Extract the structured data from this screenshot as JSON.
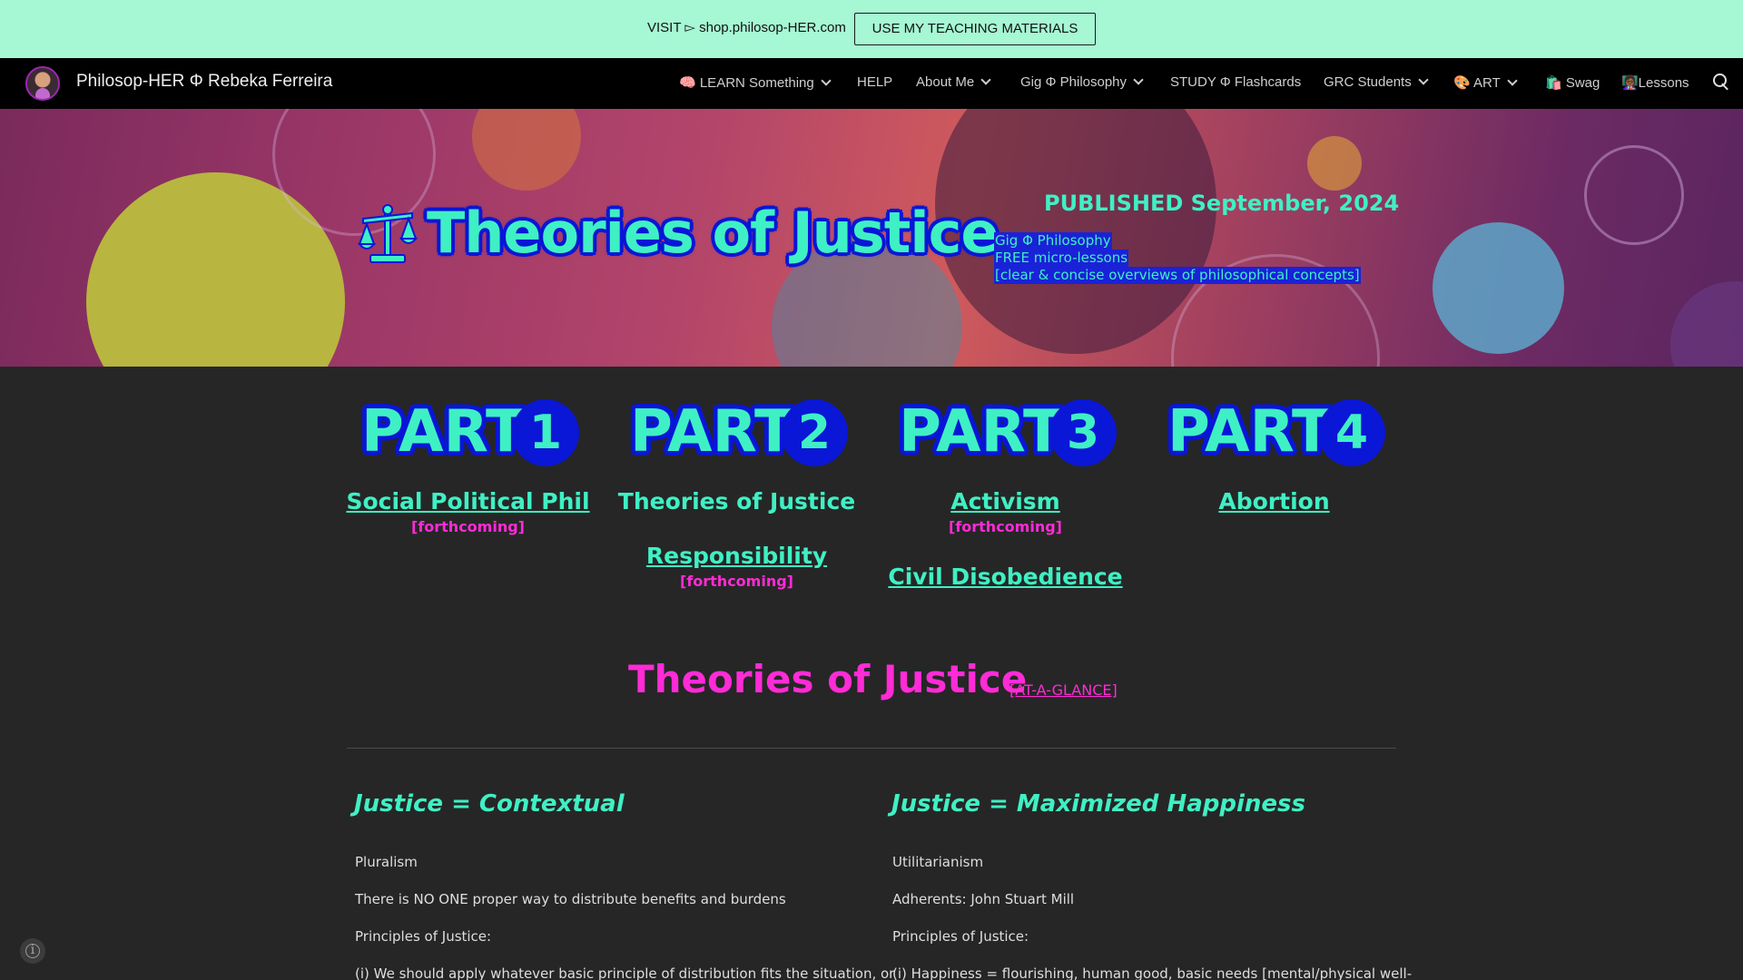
{
  "announcement": {
    "text": "VISIT ▻ shop.philosop-HER.com",
    "button_label": "USE MY TEACHING MATERIALS",
    "background": "#a6f7d3"
  },
  "nav": {
    "site_title": "Philosop-HER Φ Rebeka Ferreira",
    "items": [
      {
        "label": "🧠 LEARN Something",
        "dropdown": true
      },
      {
        "label": "HELP",
        "dropdown": false
      },
      {
        "label": "About Me",
        "dropdown": true
      },
      {
        "label": "Gig Φ Philosophy",
        "dropdown": true
      },
      {
        "label": "STUDY Φ Flashcards",
        "dropdown": false
      },
      {
        "label": "GRC Students",
        "dropdown": true
      },
      {
        "label": "🎨 ART",
        "dropdown": true
      },
      {
        "label": "🛍️ Swag",
        "dropdown": false
      },
      {
        "label": "👩🏾‍🏫Lessons",
        "dropdown": false
      }
    ],
    "search_icon": "search-icon"
  },
  "hero": {
    "title": "Theories of Justice",
    "icon": "scales-icon",
    "published": "PUBLISHED September, 2024",
    "note_lines": [
      "Gig Φ Philosophy",
      "FREE micro-lessons",
      "[clear & concise overviews of philosophical concepts]"
    ]
  },
  "parts": [
    {
      "word": "PART",
      "number": "1",
      "link": "Social Political Phil",
      "status": "[forthcoming]"
    },
    {
      "word": "PART",
      "number": "2",
      "current": "Theories of Justice",
      "link": "Responsibility",
      "status": "[forthcoming]"
    },
    {
      "word": "PART",
      "number": "3",
      "link": "Activism",
      "status": "[forthcoming]",
      "link2": "Civil Disobedience"
    },
    {
      "word": "PART",
      "number": "4",
      "link": "Abortion"
    }
  ],
  "section": {
    "title": "Theories of Justice",
    "glance_link": "[AT-A-GLANCE]"
  },
  "columns": [
    {
      "heading": "Justice = Contextual",
      "lines": [
        "Pluralism",
        "There is NO ONE proper way to distribute benefits and burdens",
        "Principles of Justice:",
        "(i) We should apply whatever basic principle of distribution fits the situation, or"
      ]
    },
    {
      "heading": "Justice = Maximized Happiness",
      "lines": [
        "Utilitarianism",
        "Adherents: John Stuart Mill",
        "Principles of Justice:",
        "(i) Happiness = flourishing, human good, basic needs [mental/physical well-"
      ]
    }
  ],
  "colors": {
    "accent_teal": "#3ff0c4",
    "accent_blue": "#0a17d6",
    "accent_magenta": "#ff2bd6",
    "page_background": "#262626"
  }
}
